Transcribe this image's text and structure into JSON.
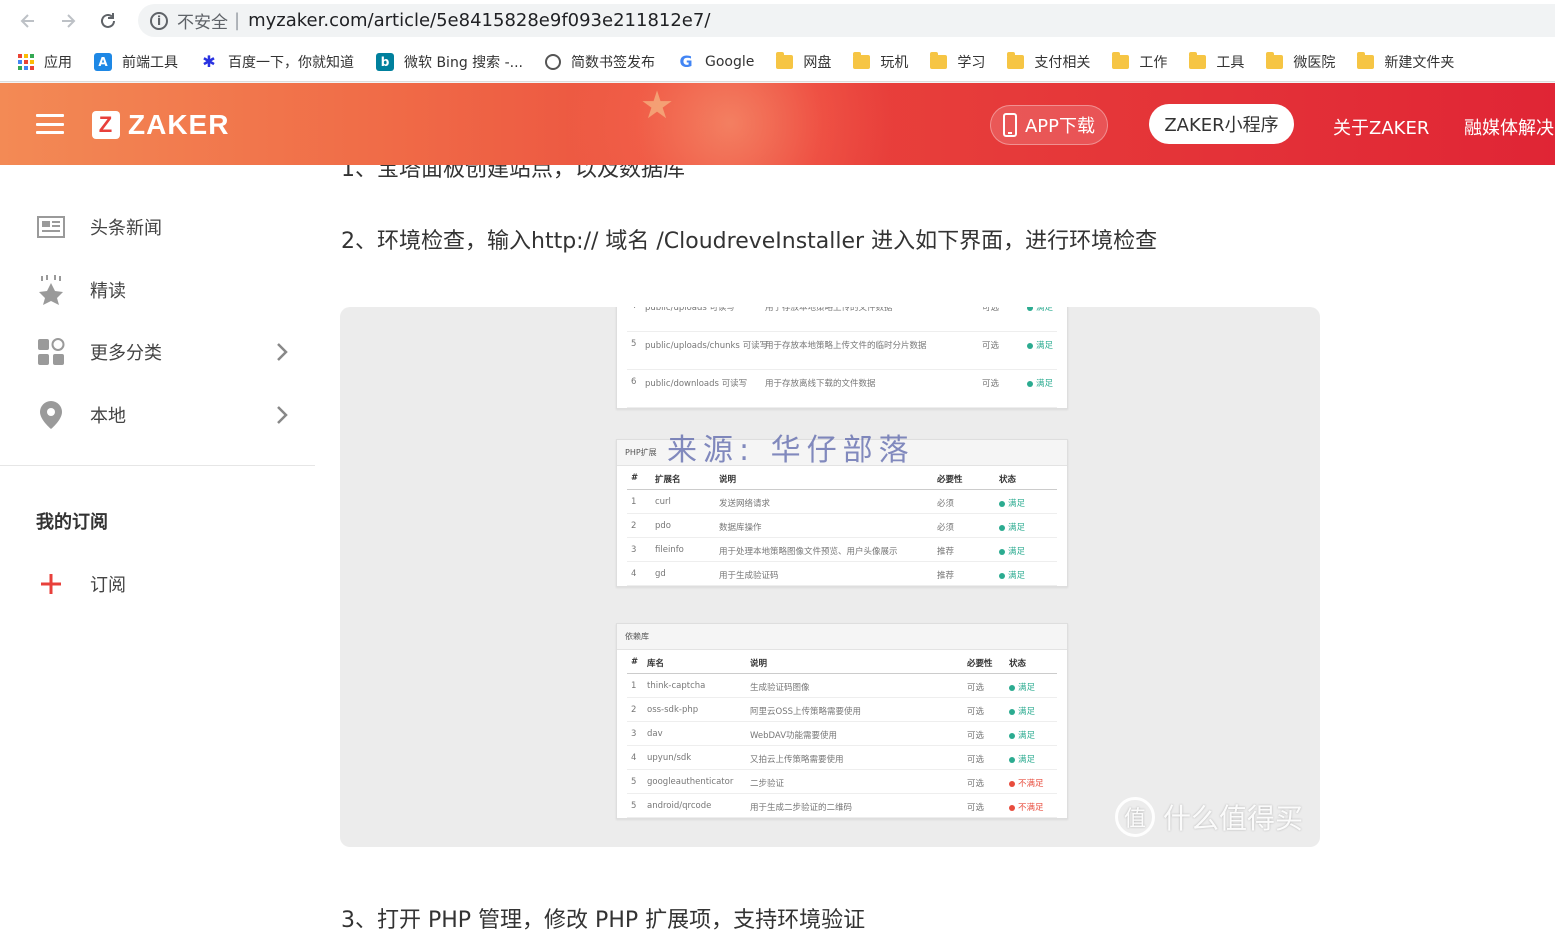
{
  "browser": {
    "insecure_label": "不安全",
    "url": "myzaker.com/article/5e8415828e9f093e211812e7/"
  },
  "bookmarks": [
    {
      "label": "应用",
      "icon": "apps-grid-icon"
    },
    {
      "label": "前端工具",
      "icon": "tool-a-icon"
    },
    {
      "label": "百度一下，你就知道",
      "icon": "baidu-paw-icon"
    },
    {
      "label": "微软 Bing 搜索 -...",
      "icon": "bing-icon"
    },
    {
      "label": "简数书签发布",
      "icon": "globe-icon"
    },
    {
      "label": "Google",
      "icon": "google-g-icon"
    },
    {
      "label": "网盘",
      "icon": "folder-icon"
    },
    {
      "label": "玩机",
      "icon": "folder-icon"
    },
    {
      "label": "学习",
      "icon": "folder-icon"
    },
    {
      "label": "支付相关",
      "icon": "folder-icon"
    },
    {
      "label": "工作",
      "icon": "folder-icon"
    },
    {
      "label": "工具",
      "icon": "folder-icon"
    },
    {
      "label": "微医院",
      "icon": "folder-icon"
    },
    {
      "label": "新建文件夹",
      "icon": "folder-icon"
    }
  ],
  "header": {
    "logo_mark": "Z",
    "logo_text": "ZAKER",
    "app_download": "APP下载",
    "mini_program": "ZAKER小程序",
    "about": "关于ZAKER",
    "media_solution": "融媒体解决"
  },
  "sidebar": {
    "items": [
      {
        "label": "头条新闻",
        "icon": "newspaper-icon"
      },
      {
        "label": "精读",
        "icon": "star-icon"
      },
      {
        "label": "更多分类",
        "icon": "grid-icon"
      },
      {
        "label": "本地",
        "icon": "location-pin-icon"
      }
    ],
    "section_title": "我的订阅",
    "subscribe": "订阅"
  },
  "article": {
    "cut_paragraph": "1、宝塔面板创建站点，以及数据库",
    "step2": "2、环境检查，输入http:// 域名 /CloudreveInstaller 进入如下界面，进行环境检查",
    "step3": "3、打开 PHP 管理，修改 PHP 扩展项，支持环境验证",
    "screenshot": {
      "watermark": "来源: 华仔部落",
      "site_watermark": "什么值得买",
      "site_watermark_mark": "值",
      "dir_rows": [
        {
          "n": "4",
          "name": "public/uploads 可读写",
          "desc": "用于存放本地策略上传的文件数据",
          "req": "可选",
          "status": "满足"
        },
        {
          "n": "5",
          "name": "public/uploads/chunks 可读写",
          "desc": "用于存放本地策略上传文件的临时分片数据",
          "req": "可选",
          "status": "满足"
        },
        {
          "n": "6",
          "name": "public/downloads 可读写",
          "desc": "用于存放离线下载的文件数据",
          "req": "可选",
          "status": "满足"
        }
      ],
      "php_ext": {
        "title": "PHP扩展",
        "headers": [
          "#",
          "扩展名",
          "说明",
          "必要性",
          "状态"
        ],
        "rows": [
          {
            "n": "1",
            "name": "curl",
            "desc": "发送网络请求",
            "req": "必须",
            "status": "满足"
          },
          {
            "n": "2",
            "name": "pdo",
            "desc": "数据库操作",
            "req": "必须",
            "status": "满足"
          },
          {
            "n": "3",
            "name": "fileinfo",
            "desc": "用于处理本地策略图像文件预览、用户头像展示",
            "req": "推荐",
            "status": "满足"
          },
          {
            "n": "4",
            "name": "gd",
            "desc": "用于生成验证码",
            "req": "推荐",
            "status": "满足"
          }
        ]
      },
      "deps": {
        "title": "依赖库",
        "headers": [
          "#",
          "库名",
          "说明",
          "必要性",
          "状态"
        ],
        "rows": [
          {
            "n": "1",
            "name": "think-captcha",
            "desc": "生成验证码图像",
            "req": "可选",
            "status": "满足",
            "ok": true
          },
          {
            "n": "2",
            "name": "oss-sdk-php",
            "desc": "阿里云OSS上传策略需要使用",
            "req": "可选",
            "status": "满足",
            "ok": true
          },
          {
            "n": "3",
            "name": "dav",
            "desc": "WebDAV功能需要使用",
            "req": "可选",
            "status": "满足",
            "ok": true
          },
          {
            "n": "4",
            "name": "upyun/sdk",
            "desc": "又拍云上传策略需要使用",
            "req": "可选",
            "status": "满足",
            "ok": true
          },
          {
            "n": "5",
            "name": "googleauthenticator",
            "desc": "二步验证",
            "req": "可选",
            "status": "不满足",
            "ok": false
          },
          {
            "n": "5",
            "name": "android/qrcode",
            "desc": "用于生成二步验证的二维码",
            "req": "可选",
            "status": "不满足",
            "ok": false
          }
        ]
      }
    }
  },
  "colors": {
    "brand_red": "#e8403b",
    "ok_green": "#2bab90",
    "error_red": "#e84c3d"
  }
}
